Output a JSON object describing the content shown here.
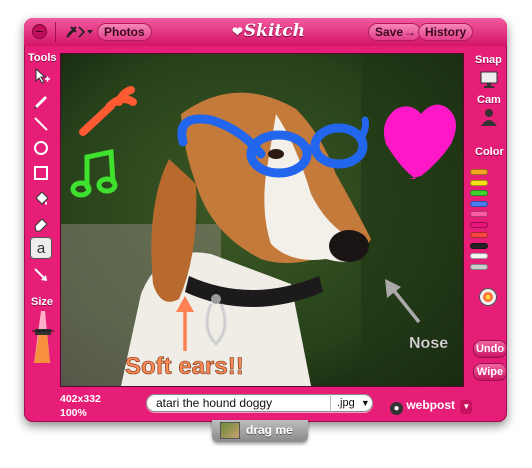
{
  "window": {
    "logo": "Skitch",
    "tools_menu_icon": "tools-icon",
    "photos_button": "Photos",
    "save_button": "Save",
    "history_button": "History"
  },
  "left_panel": {
    "tools_label": "Tools",
    "tools": [
      "pointer-icon",
      "pen-icon",
      "line-icon",
      "ellipse-icon",
      "rectangle-icon",
      "fill-icon",
      "eraser-icon",
      "text-icon",
      "arrow-icon"
    ],
    "selected_tool": "text-icon",
    "size_label": "Size"
  },
  "right_panel": {
    "snap_label": "Snap",
    "cam_label": "Cam",
    "color_label": "Color",
    "colors": [
      "#f5a623",
      "#f7e017",
      "#3fd12f",
      "#4a7bf0",
      "#ff5ca8",
      "#e8147a",
      "#ff4444",
      "#222222",
      "#f4f4f4",
      "#cccccc"
    ],
    "undo_button": "Undo",
    "wipe_button": "Wipe"
  },
  "canvas": {
    "annotation_soft_ears": "Soft ears!!",
    "annotation_nose": "Nose",
    "dimensions": "402x332",
    "zoom": "100%"
  },
  "footer": {
    "filename_value": "atari the hound doggy",
    "format": ".jpg",
    "share_target": "webpost",
    "drag_label": "drag me"
  }
}
